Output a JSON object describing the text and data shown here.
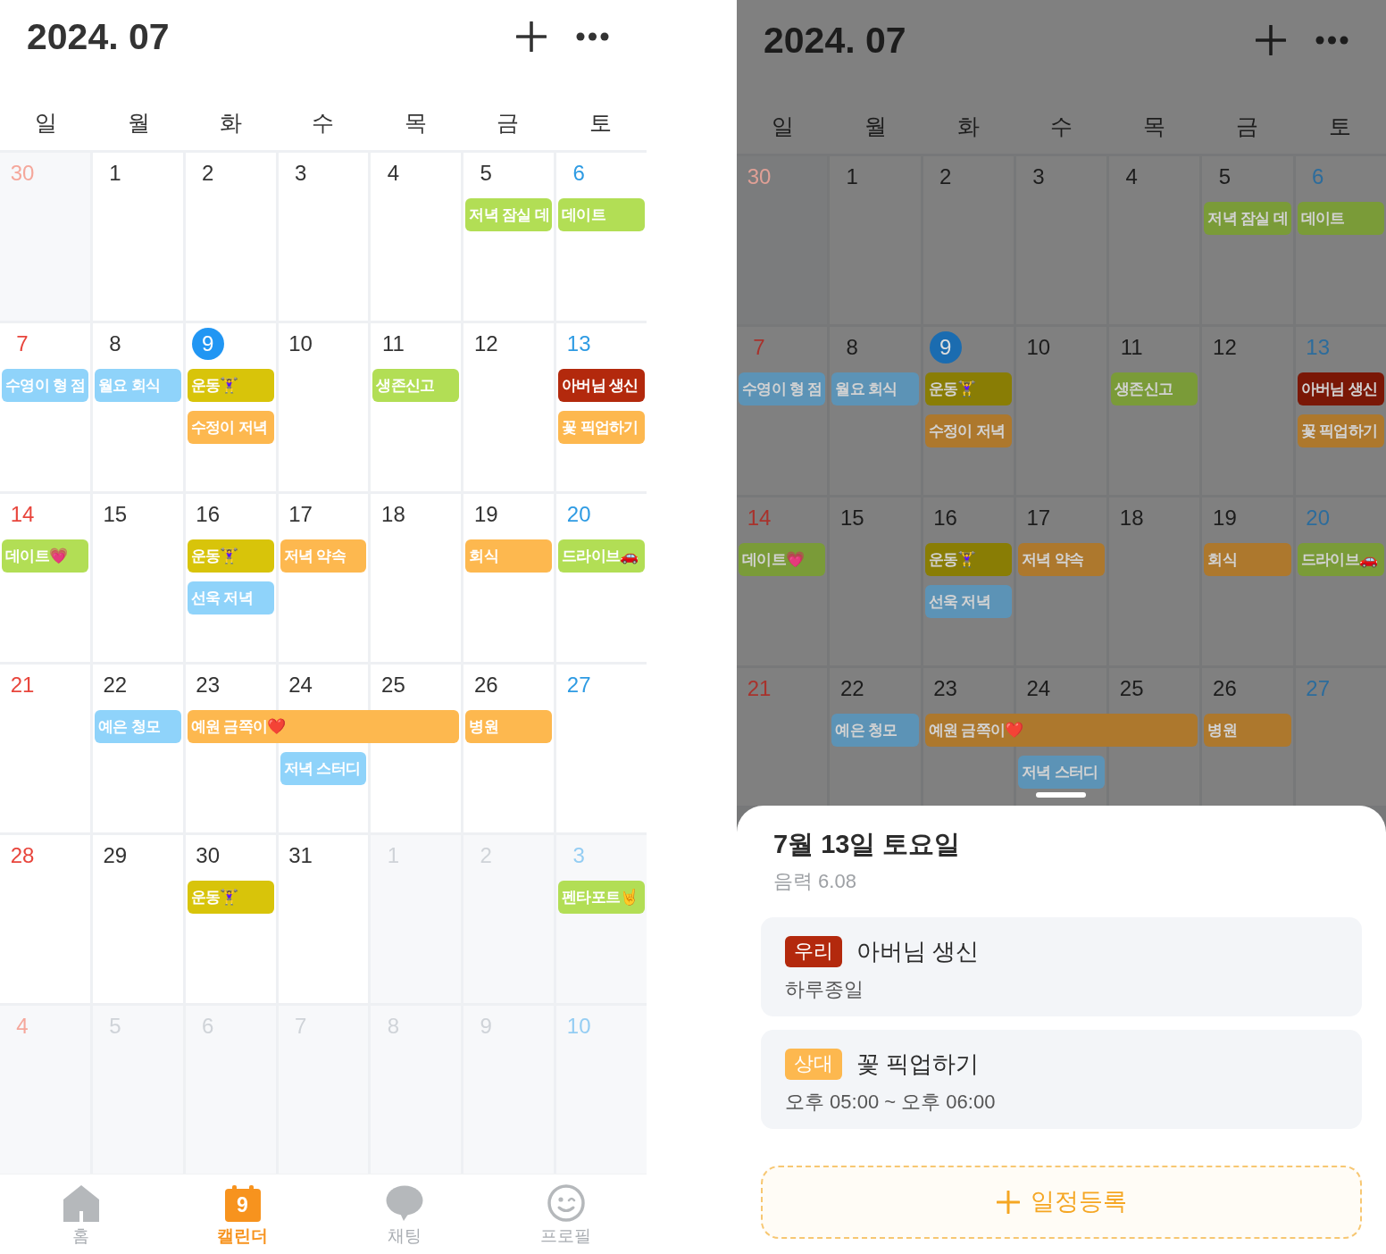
{
  "screens": [
    {
      "dimmed": false,
      "header": {
        "title": "2024. 07"
      },
      "weekdays": [
        "일",
        "월",
        "화",
        "수",
        "목",
        "금",
        "토"
      ],
      "weeks": [
        {
          "days": [
            {
              "label": "30",
              "in_month": false,
              "today": false
            },
            {
              "label": "1",
              "in_month": true,
              "today": false
            },
            {
              "label": "2",
              "in_month": true,
              "today": false
            },
            {
              "label": "3",
              "in_month": true,
              "today": false
            },
            {
              "label": "4",
              "in_month": true,
              "today": false
            },
            {
              "label": "5",
              "in_month": true,
              "today": false,
              "events": [
                {
                  "kind": "bar",
                  "title": "저녁 잠실 데",
                  "color": "#b2de55"
                }
              ]
            },
            {
              "label": "6",
              "in_month": true,
              "today": false,
              "events": [
                {
                  "kind": "bar",
                  "title": "데이트",
                  "color": "#b2de55"
                }
              ]
            }
          ]
        },
        {
          "days": [
            {
              "label": "7",
              "in_month": true,
              "today": false,
              "events": [
                {
                  "kind": "bar",
                  "title": "수영이 형 점",
                  "color": "#8fd3fa"
                }
              ]
            },
            {
              "label": "8",
              "in_month": true,
              "today": false,
              "events": [
                {
                  "kind": "bar",
                  "title": "월요 회식",
                  "color": "#8fd3fa"
                }
              ]
            },
            {
              "label": "9",
              "in_month": true,
              "today": true,
              "events": [
                {
                  "kind": "bar",
                  "title": "운동🏋️‍♀️",
                  "color": "#d8c40a"
                },
                {
                  "kind": "bar",
                  "title": "수정이 저녁",
                  "color": "#fdb84f"
                }
              ]
            },
            {
              "label": "10",
              "in_month": true,
              "today": false
            },
            {
              "label": "11",
              "in_month": true,
              "today": false,
              "events": [
                {
                  "kind": "bar",
                  "title": "생존신고",
                  "color": "#b2de55"
                }
              ]
            },
            {
              "label": "12",
              "in_month": true,
              "today": false
            },
            {
              "label": "13",
              "in_month": true,
              "today": false,
              "events": [
                {
                  "kind": "bar",
                  "title": "아버님 생신",
                  "color": "#b3290d"
                },
                {
                  "kind": "bar",
                  "title": "꽃 픽업하기",
                  "color": "#fdb84f"
                }
              ]
            }
          ]
        },
        {
          "days": [
            {
              "label": "14",
              "in_month": true,
              "today": false,
              "events": [
                {
                  "kind": "bar",
                  "title": "데이트💗",
                  "color": "#b2de55"
                }
              ]
            },
            {
              "label": "15",
              "in_month": true,
              "today": false
            },
            {
              "label": "16",
              "in_month": true,
              "today": false,
              "events": [
                {
                  "kind": "bar",
                  "title": "운동🏋️‍♀️",
                  "color": "#d8c40a"
                },
                {
                  "kind": "bar",
                  "title": "선욱 저녁",
                  "color": "#8fd3fa"
                }
              ]
            },
            {
              "label": "17",
              "in_month": true,
              "today": false,
              "events": [
                {
                  "kind": "bar",
                  "title": "저녁 약속",
                  "color": "#fdb84f"
                }
              ]
            },
            {
              "label": "18",
              "in_month": true,
              "today": false
            },
            {
              "label": "19",
              "in_month": true,
              "today": false,
              "events": [
                {
                  "kind": "bar",
                  "title": "회식",
                  "color": "#fdb84f"
                }
              ]
            },
            {
              "label": "20",
              "in_month": true,
              "today": false,
              "events": [
                {
                  "kind": "bar",
                  "title": "드라이브🚗",
                  "color": "#b2de55"
                }
              ]
            }
          ]
        },
        {
          "days": [
            {
              "label": "21",
              "in_month": true,
              "today": false
            },
            {
              "label": "22",
              "in_month": true,
              "today": false,
              "events": [
                {
                  "kind": "bar",
                  "title": "예은 청모",
                  "color": "#8fd3fa"
                }
              ]
            },
            {
              "label": "23",
              "in_month": true,
              "today": false,
              "events": [
                {
                  "kind": "bar",
                  "title": "예원 금쪽이❤️",
                  "color": "#fdb84f"
                }
              ]
            },
            {
              "label": "24",
              "in_month": true,
              "today": false,
              "events": [
                {
                  "kind": "continued"
                },
                {
                  "kind": "bar",
                  "title": "저녁 스터디",
                  "color": "#8fd3fa"
                }
              ]
            },
            {
              "label": "25",
              "in_month": true,
              "today": false,
              "events": [
                {
                  "kind": "continued"
                }
              ]
            },
            {
              "label": "26",
              "in_month": true,
              "today": false,
              "events": [
                {
                  "kind": "bar",
                  "title": "병원",
                  "color": "#fdb84f"
                }
              ]
            },
            {
              "label": "27",
              "in_month": true,
              "today": false
            }
          ]
        },
        {
          "days": [
            {
              "label": "28",
              "in_month": true,
              "today": false
            },
            {
              "label": "29",
              "in_month": true,
              "today": false
            },
            {
              "label": "30",
              "in_month": true,
              "today": false,
              "events": [
                {
                  "kind": "bar",
                  "title": "운동🏋️‍♀️",
                  "color": "#d8c40a"
                }
              ]
            },
            {
              "label": "31",
              "in_month": true,
              "today": false
            },
            {
              "label": "1",
              "in_month": false,
              "today": false
            },
            {
              "label": "2",
              "in_month": false,
              "today": false
            },
            {
              "label": "3",
              "in_month": false,
              "today": false,
              "events": [
                {
                  "kind": "bar",
                  "title": "펜타포트🤘",
                  "color": "#b2de55"
                }
              ]
            }
          ]
        },
        {
          "days": [
            {
              "label": "4",
              "in_month": false,
              "today": false
            },
            {
              "label": "5",
              "in_month": false,
              "today": false
            },
            {
              "label": "6",
              "in_month": false,
              "today": false
            },
            {
              "label": "7",
              "in_month": false,
              "today": false
            },
            {
              "label": "8",
              "in_month": false,
              "today": false
            },
            {
              "label": "9",
              "in_month": false,
              "today": false
            },
            {
              "label": "10",
              "in_month": false,
              "today": false
            }
          ]
        }
      ],
      "tab_bar": [
        {
          "label": "홈",
          "selected": false
        },
        {
          "label": "캘린더",
          "icon_label": "9",
          "selected": true
        },
        {
          "label": "채팅",
          "selected": false
        },
        {
          "label": "프로필",
          "selected": false
        }
      ]
    },
    {
      "dimmed": true,
      "header": {
        "title": "2024. 07"
      },
      "weekdays": [
        "일",
        "월",
        "화",
        "수",
        "목",
        "금",
        "토"
      ],
      "weeks": [
        {
          "days": [
            {
              "label": "30",
              "in_month": false,
              "today": false
            },
            {
              "label": "1",
              "in_month": true,
              "today": false
            },
            {
              "label": "2",
              "in_month": true,
              "today": false
            },
            {
              "label": "3",
              "in_month": true,
              "today": false
            },
            {
              "label": "4",
              "in_month": true,
              "today": false
            },
            {
              "label": "5",
              "in_month": true,
              "today": false,
              "events": [
                {
                  "kind": "bar",
                  "title": "저녁 잠실 데",
                  "color": "#7a9b38"
                }
              ]
            },
            {
              "label": "6",
              "in_month": true,
              "today": false,
              "events": [
                {
                  "kind": "bar",
                  "title": "데이트",
                  "color": "#7a9b38"
                }
              ]
            }
          ]
        },
        {
          "days": [
            {
              "label": "7",
              "in_month": true,
              "today": false,
              "events": [
                {
                  "kind": "bar",
                  "title": "수영이 형 점",
                  "color": "#5c93b6"
                }
              ]
            },
            {
              "label": "8",
              "in_month": true,
              "today": false,
              "events": [
                {
                  "kind": "bar",
                  "title": "월요 회식",
                  "color": "#5c93b6"
                }
              ]
            },
            {
              "label": "9",
              "in_month": true,
              "today": true,
              "events": [
                {
                  "kind": "bar",
                  "title": "운동🏋️‍♀️",
                  "color": "#897d05"
                },
                {
                  "kind": "bar",
                  "title": "수정이 저녁",
                  "color": "#ad782d"
                }
              ]
            },
            {
              "label": "10",
              "in_month": true,
              "today": false
            },
            {
              "label": "11",
              "in_month": true,
              "today": false,
              "events": [
                {
                  "kind": "bar",
                  "title": "생존신고",
                  "color": "#7a9b38"
                }
              ]
            },
            {
              "label": "12",
              "in_month": true,
              "today": false
            },
            {
              "label": "13",
              "in_month": true,
              "today": false,
              "events": [
                {
                  "kind": "bar",
                  "title": "아버님 생신",
                  "color": "#7a1706"
                },
                {
                  "kind": "bar",
                  "title": "꽃 픽업하기",
                  "color": "#ad782d"
                }
              ]
            }
          ]
        },
        {
          "days": [
            {
              "label": "14",
              "in_month": true,
              "today": false,
              "events": [
                {
                  "kind": "bar",
                  "title": "데이트💗",
                  "color": "#7a9b38"
                }
              ]
            },
            {
              "label": "15",
              "in_month": true,
              "today": false
            },
            {
              "label": "16",
              "in_month": true,
              "today": false,
              "events": [
                {
                  "kind": "bar",
                  "title": "운동🏋️‍♀️",
                  "color": "#897d05"
                },
                {
                  "kind": "bar",
                  "title": "선욱 저녁",
                  "color": "#5c93b6"
                }
              ]
            },
            {
              "label": "17",
              "in_month": true,
              "today": false,
              "events": [
                {
                  "kind": "bar",
                  "title": "저녁 약속",
                  "color": "#ad782d"
                }
              ]
            },
            {
              "label": "18",
              "in_month": true,
              "today": false
            },
            {
              "label": "19",
              "in_month": true,
              "today": false,
              "events": [
                {
                  "kind": "bar",
                  "title": "회식",
                  "color": "#ad782d"
                }
              ]
            },
            {
              "label": "20",
              "in_month": true,
              "today": false,
              "events": [
                {
                  "kind": "bar",
                  "title": "드라이브🚗",
                  "color": "#7a9b38"
                }
              ]
            }
          ]
        },
        {
          "days": [
            {
              "label": "21",
              "in_month": true,
              "today": false
            },
            {
              "label": "22",
              "in_month": true,
              "today": false,
              "events": [
                {
                  "kind": "bar",
                  "title": "예은 청모",
                  "color": "#5c93b6"
                }
              ]
            },
            {
              "label": "23",
              "in_month": true,
              "today": false,
              "events": [
                {
                  "kind": "bar",
                  "title": "예원 금쪽이❤️",
                  "color": "#ad782d"
                }
              ]
            },
            {
              "label": "24",
              "in_month": true,
              "today": false,
              "events": [
                {
                  "kind": "continued"
                },
                {
                  "kind": "bar",
                  "title": "저녁 스터디",
                  "color": "#5c93b6"
                }
              ]
            },
            {
              "label": "25",
              "in_month": true,
              "today": false,
              "events": [
                {
                  "kind": "continued"
                }
              ]
            },
            {
              "label": "26",
              "in_month": true,
              "today": false,
              "events": [
                {
                  "kind": "bar",
                  "title": "병원",
                  "color": "#ad782d"
                }
              ]
            },
            {
              "label": "27",
              "in_month": true,
              "today": false
            }
          ]
        }
      ],
      "sheet": {
        "title": "7월 13일 토요일",
        "lunar": "음력 6.08",
        "events": [
          {
            "tag": "우리",
            "color": "#b3290d",
            "title": "아버님 생신",
            "time": "하루종일"
          },
          {
            "tag": "상대",
            "color": "#fdb84f",
            "title": "꽃 픽업하기",
            "time": "오후 05:00 ~ 오후 06:00"
          }
        ],
        "add_button": {
          "label": "일정등록"
        }
      }
    }
  ]
}
